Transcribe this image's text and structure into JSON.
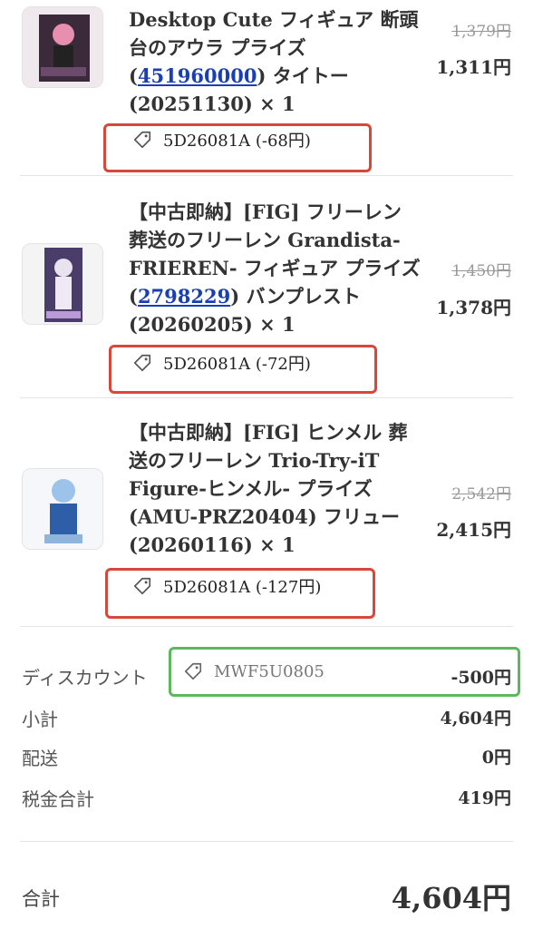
{
  "items": [
    {
      "title_pre": "Desktop Cute フィギュア 断頭台のアウラ プライズ(",
      "title_link": "451960000",
      "title_post": ") タイトー (20251130) × 1",
      "price_original": "1,379円",
      "price": "1,311円",
      "coupon": "5D26081A (-68円)"
    },
    {
      "title_pre": "【中古即納】[FIG] フリーレン 葬送のフリーレン Grandista-FRIEREN- フィギュア プライズ(",
      "title_link": "2798229",
      "title_post": ") バンプレスト(20260205) × 1",
      "price_original": "1,450円",
      "price": "1,378円",
      "coupon": "5D26081A (-72円)"
    },
    {
      "title_pre": "【中古即納】[FIG] ヒンメル 葬送のフリーレン Trio-Try-iT Figure-ヒンメル- プライズ(AMU-PRZ20404) フリュー(20260116) × 1",
      "title_link": "",
      "title_post": "",
      "price_original": "2,542円",
      "price": "2,415円",
      "coupon": "5D26081A (-127円)"
    }
  ],
  "summary": {
    "discount_label": "ディスカウント",
    "discount_code": "MWF5U0805",
    "discount_value": "-500円",
    "subtotal_label": "小計",
    "subtotal_value": "4,604円",
    "shipping_label": "配送",
    "shipping_value": "0円",
    "tax_label": "税金合計",
    "tax_value": "419円",
    "total_label": "合計",
    "total_value": "4,604円"
  },
  "colors": {
    "annotation_red": "#d9463a",
    "annotation_green": "#5cb85c",
    "link_blue": "#1a3fb5"
  },
  "icons": [
    "tag-icon"
  ]
}
